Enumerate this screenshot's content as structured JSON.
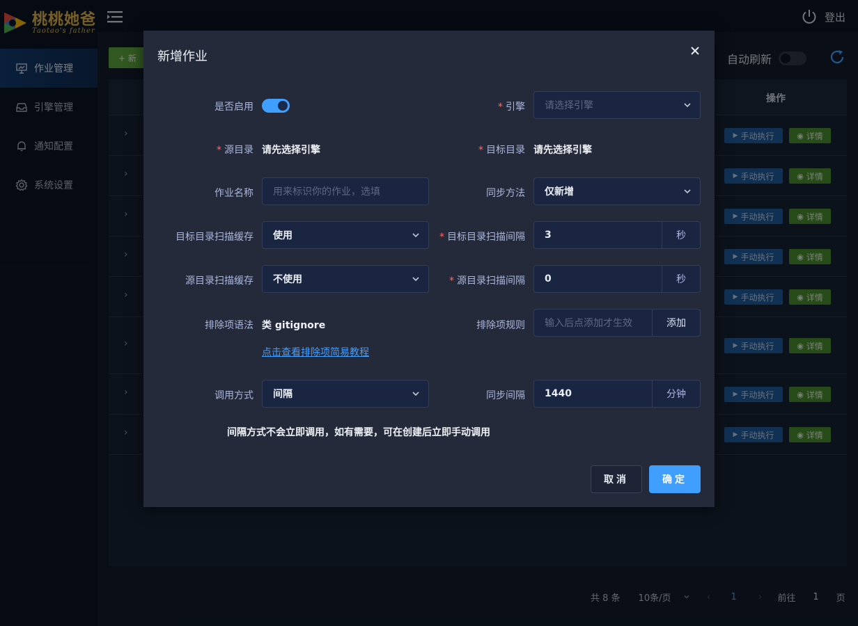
{
  "brand": {
    "name": "桃桃她爸",
    "sub": "Taotao's father"
  },
  "sidebar": {
    "items": [
      {
        "label": "作业管理",
        "icon": "presentation-icon",
        "active": true
      },
      {
        "label": "引擎管理",
        "icon": "inbox-icon"
      },
      {
        "label": "通知配置",
        "icon": "bell-icon"
      },
      {
        "label": "系统设置",
        "icon": "gear-icon"
      }
    ]
  },
  "topbar": {
    "logout_label": "登出"
  },
  "toolbar": {
    "new_label": "+ 新",
    "auto_refresh_label": "自动刷新"
  },
  "table": {
    "op_header": "操作",
    "run_label": "手动执行",
    "detail_label": "详情",
    "row_count": 8
  },
  "pagination": {
    "total": "共 8 条",
    "page_size": "10条/页",
    "current_page": "1",
    "goto_label": "前往",
    "goto_value": "1",
    "page_suffix": "页"
  },
  "dialog": {
    "title": "新增作业",
    "fields": {
      "enabled_label": "是否启用",
      "engine_label": "引擎",
      "engine_placeholder": "请选择引擎",
      "src_dir_label": "源目录",
      "src_dir_value": "请先选择引擎",
      "dst_dir_label": "目标目录",
      "dst_dir_value": "请先选择引擎",
      "job_name_label": "作业名称",
      "job_name_placeholder": "用来标识你的作业，选填",
      "sync_method_label": "同步方法",
      "sync_method_value": "仅新增",
      "dst_cache_label": "目标目录扫描缓存",
      "dst_cache_value": "使用",
      "dst_interval_label": "目标目录扫描间隔",
      "dst_interval_value": "3",
      "dst_interval_unit": "秒",
      "src_cache_label": "源目录扫描缓存",
      "src_cache_value": "不使用",
      "src_interval_label": "源目录扫描间隔",
      "src_interval_value": "0",
      "src_interval_unit": "秒",
      "exclude_syntax_label": "排除项语法",
      "exclude_syntax_value": "类 gitignore",
      "exclude_rule_label": "排除项规则",
      "exclude_rule_placeholder": "输入后点添加才生效",
      "exclude_add_label": "添加",
      "exclude_tutorial_link": "点击查看排除项简易教程",
      "invoke_label": "调用方式",
      "invoke_value": "间隔",
      "sync_interval_label": "同步间隔",
      "sync_interval_value": "1440",
      "sync_interval_unit": "分钟",
      "invoke_note": "间隔方式不会立即调用，如有需要，可在创建后立即手动调用"
    },
    "cancel_label": "取消",
    "confirm_label": "确定"
  },
  "colors": {
    "accent": "#409eff",
    "required": "#f56c6c",
    "success": "#5aa13d"
  }
}
